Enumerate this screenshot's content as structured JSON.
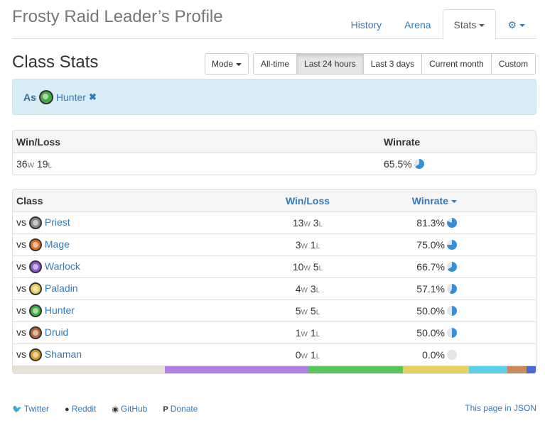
{
  "header": {
    "title": "Frosty Raid Leader’s Profile",
    "nav": [
      {
        "label": "History"
      },
      {
        "label": "Arena"
      },
      {
        "label": "Stats"
      }
    ]
  },
  "section": {
    "title": "Class Stats",
    "mode_label": "Mode",
    "ranges": [
      "All-time",
      "Last 24 hours",
      "Last 3 days",
      "Current month",
      "Custom"
    ],
    "active_range": "Last 24 hours"
  },
  "filter": {
    "prefix": "As",
    "class_name": "Hunter",
    "remove_glyph": "✖",
    "class_color": "#44aa44"
  },
  "summary": {
    "headers": {
      "winloss": "Win/Loss",
      "winrate": "Winrate"
    },
    "wins": "36",
    "losses": "19",
    "win_suffix": "W",
    "loss_suffix": "L",
    "winrate": "65.5%",
    "winrate_value": 65.5
  },
  "class_table": {
    "headers": {
      "class": "Class",
      "winloss": "Win/Loss",
      "winrate": "Winrate"
    },
    "vs_label": "vs",
    "rows": [
      {
        "class": "Priest",
        "wins": "13",
        "losses": "3",
        "winrate": "81.3%",
        "winrate_value": 81.3,
        "icon_color": "#888888"
      },
      {
        "class": "Mage",
        "wins": "3",
        "losses": "1",
        "winrate": "75.0%",
        "winrate_value": 75.0,
        "icon_color": "#e0702a"
      },
      {
        "class": "Warlock",
        "wins": "10",
        "losses": "5",
        "winrate": "66.7%",
        "winrate_value": 66.7,
        "icon_color": "#8e5ad4"
      },
      {
        "class": "Paladin",
        "wins": "4",
        "losses": "3",
        "winrate": "57.1%",
        "winrate_value": 57.1,
        "icon_color": "#e8c85a"
      },
      {
        "class": "Hunter",
        "wins": "5",
        "losses": "5",
        "winrate": "50.0%",
        "winrate_value": 50.0,
        "icon_color": "#44aa44"
      },
      {
        "class": "Druid",
        "wins": "1",
        "losses": "1",
        "winrate": "50.0%",
        "winrate_value": 50.0,
        "icon_color": "#b5653a"
      },
      {
        "class": "Shaman",
        "wins": "0",
        "losses": "1",
        "winrate": "0.0%",
        "winrate_value": 0.0,
        "icon_color": "#d49a2a"
      }
    ],
    "distribution": [
      {
        "class": "Priest",
        "games": 16,
        "color": "#e6e2d4"
      },
      {
        "class": "Warlock",
        "games": 15,
        "color": "#b37fe0"
      },
      {
        "class": "Hunter",
        "games": 10,
        "color": "#5cc45c"
      },
      {
        "class": "Paladin",
        "games": 7,
        "color": "#e8d160"
      },
      {
        "class": "Mage",
        "games": 4,
        "color": "#5bd0e8"
      },
      {
        "class": "Druid",
        "games": 2,
        "color": "#c98a5c"
      },
      {
        "class": "Shaman",
        "games": 1,
        "color": "#4d6bd4"
      }
    ]
  },
  "colors": {
    "pie_fill": "#3a8ed6",
    "pie_empty": "#e5e5e5",
    "link": "#337ab7"
  },
  "footer": {
    "links": [
      {
        "icon": "twitter-icon",
        "glyph": "🐦",
        "label": "Twitter"
      },
      {
        "icon": "reddit-icon",
        "glyph": "●",
        "label": "Reddit"
      },
      {
        "icon": "github-icon",
        "glyph": "◉",
        "label": "GitHub"
      },
      {
        "icon": "paypal-icon",
        "glyph": "P",
        "label": "Donate"
      }
    ],
    "json_link": "This page in JSON"
  }
}
